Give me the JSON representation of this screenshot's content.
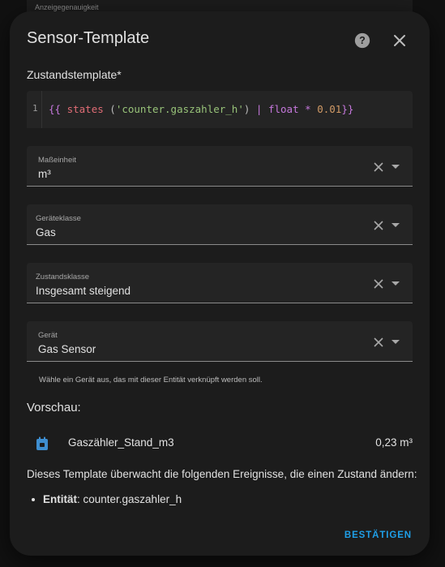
{
  "background_field": {
    "label": "Anzeigegenauigkeit"
  },
  "dialog": {
    "title": "Sensor-Template",
    "icons": {
      "help": "help-circle-icon",
      "close": "close-icon"
    },
    "state_template": {
      "label": "Zustandstemplate*",
      "line_number": "1",
      "tokens": {
        "open": "{{",
        "states": "states",
        "paren_open": "(",
        "string": "'counter.gaszahler_h'",
        "paren_close": ")",
        "pipe": "|",
        "float": "float",
        "mult": "*",
        "number": "0.01",
        "close": "}}"
      }
    },
    "fields": [
      {
        "label": "Maßeinheit",
        "value": "m³"
      },
      {
        "label": "Geräteklasse",
        "value": "Gas"
      },
      {
        "label": "Zustandsklasse",
        "value": "Insgesamt steigend"
      },
      {
        "label": "Gerät",
        "value": "Gas Sensor"
      }
    ],
    "device_helper": "Wähle ein Gerät aus, das mit dieser Entität verknüpft werden soll.",
    "preview": {
      "title": "Vorschau:",
      "entity_icon": "counter-icon",
      "entity_name": "Gaszähler_Stand_m3",
      "entity_state": "0,23 m³"
    },
    "watch_text": "Dieses Template überwacht die folgenden Ereignisse, die einen Zustand ändern:",
    "watch_items": [
      {
        "key": "Entität",
        "value": ": counter.gaszahler_h"
      }
    ],
    "confirm_label": "BESTÄTIGEN",
    "accent_color": "#1f9fe8"
  }
}
